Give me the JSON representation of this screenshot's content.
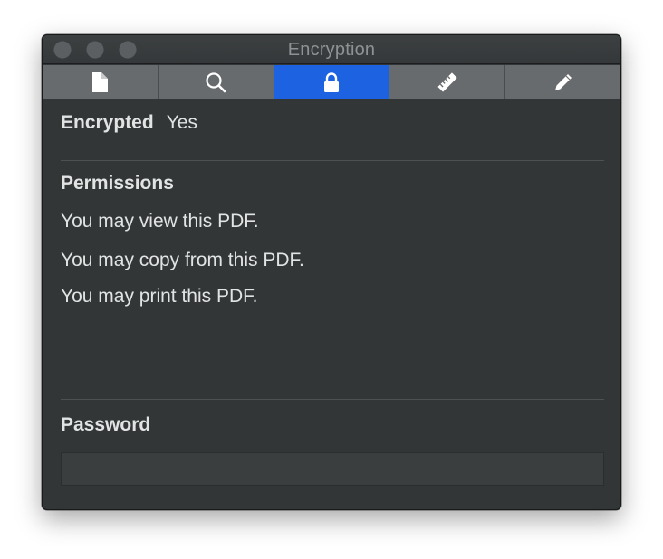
{
  "window": {
    "title": "Encryption"
  },
  "tabs": [
    {
      "name": "document-info",
      "icon": "document-icon",
      "active": false
    },
    {
      "name": "search",
      "icon": "magnifier-icon",
      "active": false
    },
    {
      "name": "encryption",
      "icon": "lock-icon",
      "active": true
    },
    {
      "name": "cropping",
      "icon": "ruler-icon",
      "active": false
    },
    {
      "name": "annotations",
      "icon": "pencil-icon",
      "active": false
    }
  ],
  "encryption": {
    "label": "Encrypted",
    "value": "Yes"
  },
  "permissions": {
    "heading": "Permissions",
    "items": [
      "You may view this PDF.",
      "You may copy from this PDF.",
      "You may print this PDF."
    ]
  },
  "password": {
    "heading": "Password",
    "value": "",
    "placeholder": ""
  },
  "colors": {
    "accent": "#1d62e0",
    "panel_background": "#323637",
    "text": "#e2e4e4"
  }
}
